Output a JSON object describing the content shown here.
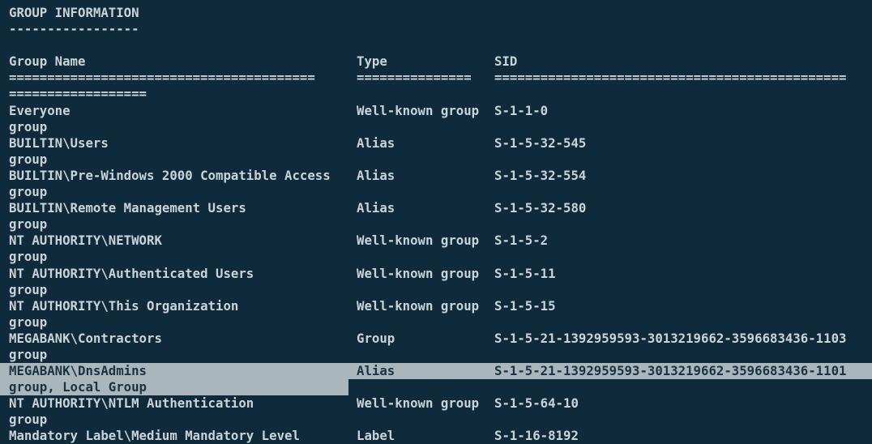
{
  "section_title": "GROUP INFORMATION",
  "section_underline": "-----------------",
  "headers": {
    "name": "Group Name",
    "type": "Type",
    "sid": "SID"
  },
  "separators": {
    "name": "========================================",
    "type": "===============",
    "sid": "==============================================",
    "wrap": "=================="
  },
  "rows": [
    {
      "name": "Everyone",
      "type": "Well-known group",
      "sid": "S-1-1-0",
      "attributes": "group"
    },
    {
      "name": "BUILTIN\\Users",
      "type": "Alias",
      "sid": "S-1-5-32-545",
      "attributes": "group"
    },
    {
      "name": "BUILTIN\\Pre-Windows 2000 Compatible Access",
      "type": "Alias",
      "sid": "S-1-5-32-554",
      "attributes": "group"
    },
    {
      "name": "BUILTIN\\Remote Management Users",
      "type": "Alias",
      "sid": "S-1-5-32-580",
      "attributes": "group"
    },
    {
      "name": "NT AUTHORITY\\NETWORK",
      "type": "Well-known group",
      "sid": "S-1-5-2",
      "attributes": "group"
    },
    {
      "name": "NT AUTHORITY\\Authenticated Users",
      "type": "Well-known group",
      "sid": "S-1-5-11",
      "attributes": "group"
    },
    {
      "name": "NT AUTHORITY\\This Organization",
      "type": "Well-known group",
      "sid": "S-1-5-15",
      "attributes": "group"
    },
    {
      "name": "MEGABANK\\Contractors",
      "type": "Group",
      "sid": "S-1-5-21-1392959593-3013219662-3596683436-1103",
      "attributes": "group"
    },
    {
      "name": "MEGABANK\\DnsAdmins",
      "type": "Alias",
      "sid": "S-1-5-21-1392959593-3013219662-3596683436-1101",
      "attributes": "group, Local Group",
      "highlighted": true
    },
    {
      "name": "NT AUTHORITY\\NTLM Authentication",
      "type": "Well-known group",
      "sid": "S-1-5-64-10",
      "attributes": "group"
    },
    {
      "name": "Mandatory Label\\Medium Mandatory Level",
      "type": "Label",
      "sid": "S-1-16-8192",
      "attributes": ""
    }
  ],
  "colors": {
    "background": "#0f2b3b",
    "text": "#c9d3d8",
    "selection": "#a9b7bd",
    "selection_text": "#1b3340"
  }
}
